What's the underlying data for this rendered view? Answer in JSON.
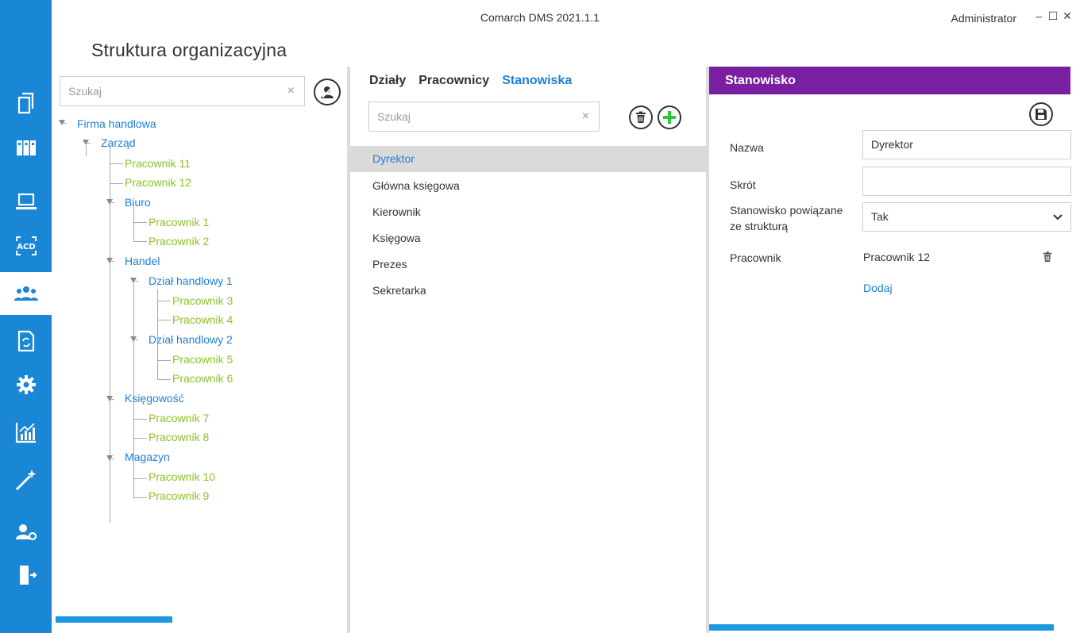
{
  "window": {
    "app_title": "Comarch DMS 2021.1.1",
    "user": "Administrator",
    "minimize": "‒",
    "maximize": "☐",
    "close": "✕"
  },
  "page": {
    "title": "Struktura organizacyjna"
  },
  "nav": {
    "accent": "#1a86d6",
    "items": [
      {
        "icon": "documents-icon"
      },
      {
        "icon": "binders-icon"
      },
      {
        "icon": "laptop-icon"
      },
      {
        "icon": "acd-icon",
        "label": "ACD"
      },
      {
        "icon": "users-icon",
        "active": true
      },
      {
        "icon": "document-sync-icon"
      },
      {
        "icon": "gear-icon"
      },
      {
        "icon": "chart-icon"
      },
      {
        "icon": "magic-wand-icon"
      },
      {
        "icon": "user-settings-icon"
      },
      {
        "icon": "exit-door-icon"
      }
    ]
  },
  "tree_panel": {
    "search_placeholder": "Szukaj",
    "clear": "×",
    "tree": [
      {
        "label": "Firma handlowa",
        "type": "node"
      },
      {
        "label": "Zarząd",
        "type": "node"
      },
      {
        "label": "Pracownik 11",
        "type": "leaf"
      },
      {
        "label": "Pracownik 12",
        "type": "leaf"
      },
      {
        "label": "Biuro",
        "type": "node"
      },
      {
        "label": "Pracownik 1",
        "type": "leaf"
      },
      {
        "label": "Pracownik 2",
        "type": "leaf"
      },
      {
        "label": "Handel",
        "type": "node"
      },
      {
        "label": "Dział handlowy 1",
        "type": "node"
      },
      {
        "label": "Pracownik 3",
        "type": "leaf"
      },
      {
        "label": "Pracownik 4",
        "type": "leaf"
      },
      {
        "label": "Dział handlowy 2",
        "type": "node"
      },
      {
        "label": "Pracownik 5",
        "type": "leaf"
      },
      {
        "label": "Pracownik 6",
        "type": "leaf"
      },
      {
        "label": "Księgowość",
        "type": "node"
      },
      {
        "label": "Pracownik 7",
        "type": "leaf"
      },
      {
        "label": "Pracownik 8",
        "type": "leaf"
      },
      {
        "label": "Magazyn",
        "type": "node"
      },
      {
        "label": "Pracownik 10",
        "type": "leaf"
      },
      {
        "label": "Pracownik 9",
        "type": "leaf"
      }
    ]
  },
  "list_panel": {
    "tabs": [
      {
        "label": "Działy"
      },
      {
        "label": "Pracownicy"
      },
      {
        "label": "Stanowiska",
        "active": true
      }
    ],
    "search_placeholder": "Szukaj",
    "clear": "×",
    "items": [
      "Dyrektor",
      "Główna księgowa",
      "Kierownik",
      "Księgowa",
      "Prezes",
      "Sekretarka"
    ],
    "selected": "Dyrektor"
  },
  "detail_panel": {
    "header": "Stanowisko",
    "header_color": "#7b1fa2",
    "fields": {
      "name_label": "Nazwa",
      "name_value": "Dyrektor",
      "short_label": "Skrót",
      "short_value": "",
      "linked_label_1": "Stanowisko powiązane",
      "linked_label_2": "ze strukturą",
      "linked_value": "Tak",
      "employee_label": "Pracownik",
      "employee_value": "Pracownik 12",
      "add_link": "Dodaj"
    }
  }
}
